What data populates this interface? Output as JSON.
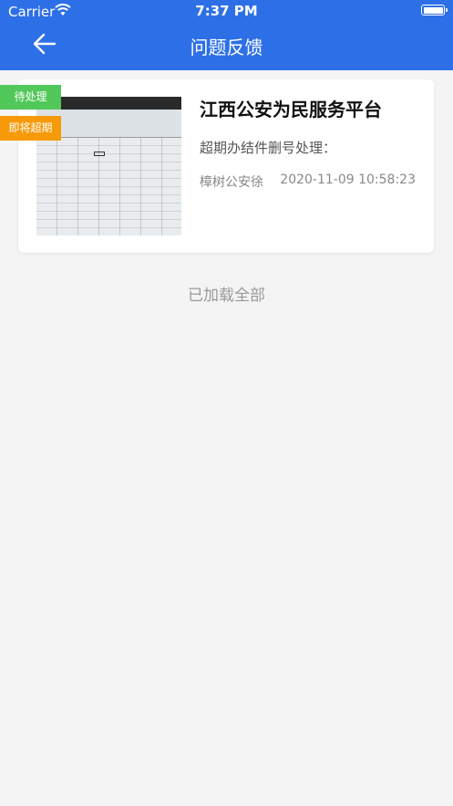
{
  "status_bar": {
    "carrier": "Carrier",
    "time": "7:37 PM"
  },
  "nav": {
    "title": "问题反馈",
    "back_icon": "arrow-left-icon"
  },
  "card": {
    "title": "江西公安为民服务平台",
    "description": "超期办结件删号处理：",
    "author": "樟树公安徐",
    "time": "2020-11-09 10:58:23",
    "tags": [
      {
        "label": "待处理",
        "color": "#52c85a"
      },
      {
        "label": "即将超期",
        "color": "#f79a0a"
      }
    ]
  },
  "footer": {
    "text": "已加载全部"
  },
  "colors": {
    "accent": "#2d6fe7",
    "background": "#f4f4f4"
  }
}
